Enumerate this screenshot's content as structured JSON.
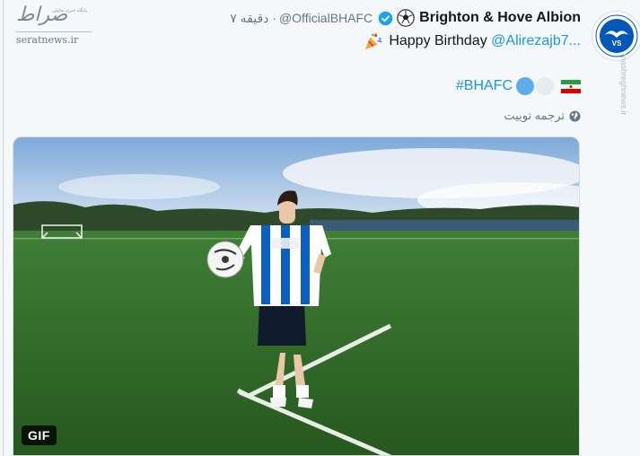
{
  "watermark": {
    "logo_text": "صراط",
    "sub_text": "پایگاه خبری تحلیلی",
    "site": "seratnews.ir",
    "side_text": "mashreghnews.ir"
  },
  "tweet": {
    "display_name": "Brighton & Hove Albion",
    "handle": "@OfficialBHAFC",
    "time": "۷ دقیقه ·",
    "birthday_text": "Happy Birthday",
    "mention": "@Alirezajb7...",
    "hashtag": "#BHAFC",
    "translate_label": "ترجمه توییت",
    "gif_label": "GIF"
  },
  "icons": {
    "verified": "verified-badge-icon",
    "ball": "soccer-ball-emoji",
    "party": "party-popper-emoji",
    "circles": [
      "blue-circle-emoji",
      "white-circle-emoji"
    ],
    "flag": "iran-flag-emoji",
    "globe": "globe-icon"
  },
  "colors": {
    "link": "#1b95e0",
    "secondary_text": "#657786",
    "verified": "#1da1f2",
    "pitch": "#2f6a2a"
  }
}
